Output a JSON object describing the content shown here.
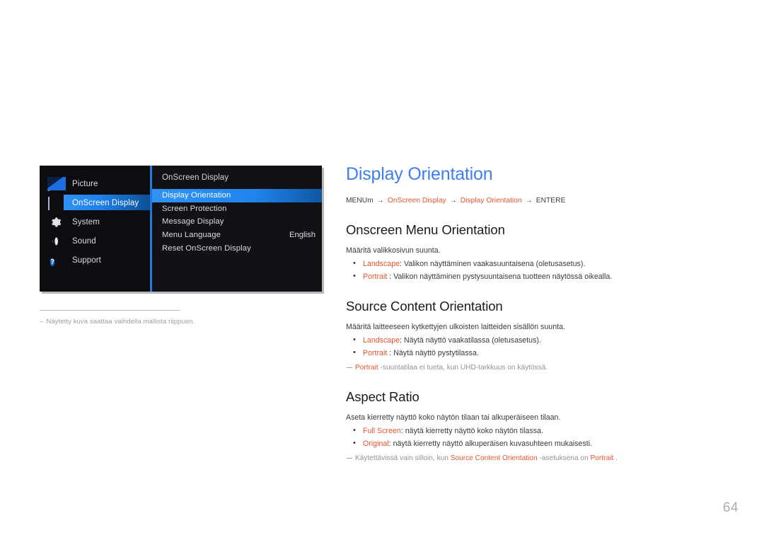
{
  "page": {
    "number": "64",
    "title": "Display Orientation",
    "title_color": "#3d7ef0",
    "accent_color": "#e8542e"
  },
  "breadcrumb": {
    "start": "MENU",
    "start_suffix": "m",
    "arrow": "→",
    "step1": "OnScreen Display",
    "step2": "Display Orientation",
    "end": "ENTER",
    "end_suffix": "E"
  },
  "osd": {
    "sidebar": {
      "items": [
        {
          "label": "Picture",
          "icon": "picture-icon",
          "active": false
        },
        {
          "label": "OnScreen Display",
          "icon": "onscreen-display-icon",
          "active": true
        },
        {
          "label": "System",
          "icon": "gear-icon",
          "active": false
        },
        {
          "label": "Sound",
          "icon": "speaker-icon",
          "active": false
        },
        {
          "label": "Support",
          "icon": "question-circle-icon",
          "active": false
        }
      ]
    },
    "submenu": {
      "title": "OnScreen Display",
      "items": [
        {
          "label": "Display Orientation",
          "value": "",
          "active": true
        },
        {
          "label": "Screen Protection",
          "value": "",
          "active": false
        },
        {
          "label": "Message Display",
          "value": "",
          "active": false
        },
        {
          "label": "Menu Language",
          "value": "English",
          "active": false
        },
        {
          "label": "Reset OnScreen Display",
          "value": "",
          "active": false
        }
      ]
    },
    "caption": {
      "dash": "–",
      "text": "Näytetty kuva saattaa vaihdella mallista riippuen."
    }
  },
  "sections": [
    {
      "heading": "Onscreen Menu Orientation",
      "lead": "Määritä valikkosivun suunta.",
      "options": [
        {
          "term": "Landscape",
          "rest": ": Valikon näyttäminen vaakasuuntaisena (oletusasetus)."
        },
        {
          "term": "Portrait",
          "rest": " : Valikon näyttäminen pystysuuntaisena tuotteen näytössä oikealla."
        }
      ],
      "notes": []
    },
    {
      "heading": "Source Content  Orientation",
      "lead": "Määritä laitteeseen kytkettyjen ulkoisten laitteiden sisällön suunta.",
      "options": [
        {
          "term": "Landscape",
          "rest": ": Näytä näyttö vaakatilassa (oletusasetus)."
        },
        {
          "term": "Portrait",
          "rest": " : Näytä näyttö pystytilassa."
        }
      ],
      "notes": [
        {
          "parts": [
            {
              "text": "Portrait",
              "accent": true
            },
            {
              "text": " -suuntatilaa ei tueta, kun UHD-tarkkuus on käytössä.",
              "accent": false
            }
          ]
        }
      ]
    },
    {
      "heading": "Aspect Ratio",
      "lead": "Aseta kierretty näyttö koko näytön tilaan tai alkuperäiseen tilaan.",
      "options": [
        {
          "term": "Full Screen",
          "rest": ": näytä kierretty näyttö koko näytön tilassa."
        },
        {
          "term": "Original",
          "rest": ": näytä kierretty näyttö alkuperäisen kuvasuhteen mukaisesti."
        }
      ],
      "notes": [
        {
          "parts": [
            {
              "text": "Käytettävissä vain silloin, kun ",
              "accent": false
            },
            {
              "text": "Source Content Orientation",
              "accent": true
            },
            {
              "text": " -asetuksena on ",
              "accent": false
            },
            {
              "text": "Portrait",
              "accent": true
            },
            {
              "text": " .",
              "accent": false
            }
          ]
        }
      ]
    }
  ]
}
